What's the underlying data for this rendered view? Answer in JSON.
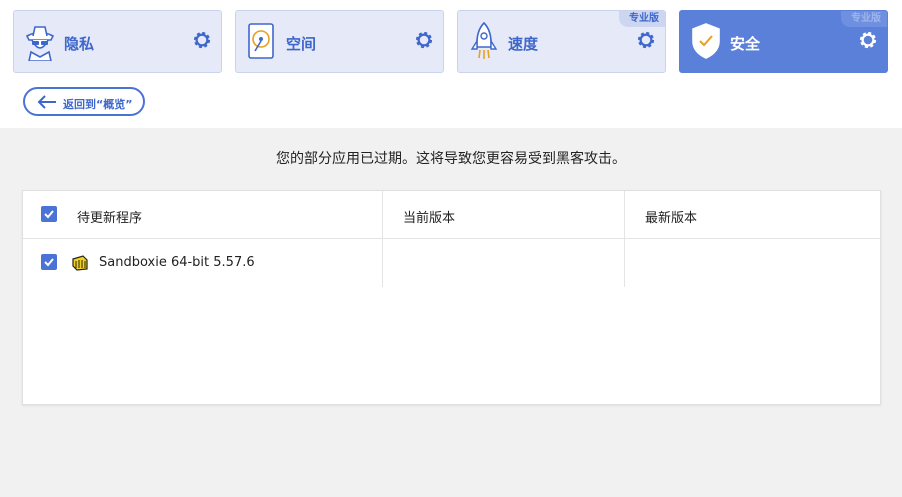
{
  "tiles": [
    {
      "label": "隐私",
      "icon": "privacy-agent-icon",
      "badge": ""
    },
    {
      "label": "空间",
      "icon": "disk-space-icon",
      "badge": ""
    },
    {
      "label": "速度",
      "icon": "rocket-icon",
      "badge": "专业版"
    },
    {
      "label": "安全",
      "icon": "shield-check-icon",
      "badge": "专业版"
    }
  ],
  "back_button": {
    "label": "返回到“概览”"
  },
  "message": "您的部分应用已过期。这将导致您更容易受到黑客攻击。",
  "table": {
    "headers": [
      "待更新程序",
      "当前版本",
      "最新版本"
    ],
    "rows": [
      {
        "name": "Sandboxie 64-bit 5.57.6",
        "current": "",
        "latest": "",
        "checked": true,
        "icon": "sandboxie-icon"
      }
    ]
  },
  "colors": {
    "accent": "#4a73d6",
    "tile_bg": "#e6eaf8",
    "active_tile": "#5a80d9"
  }
}
